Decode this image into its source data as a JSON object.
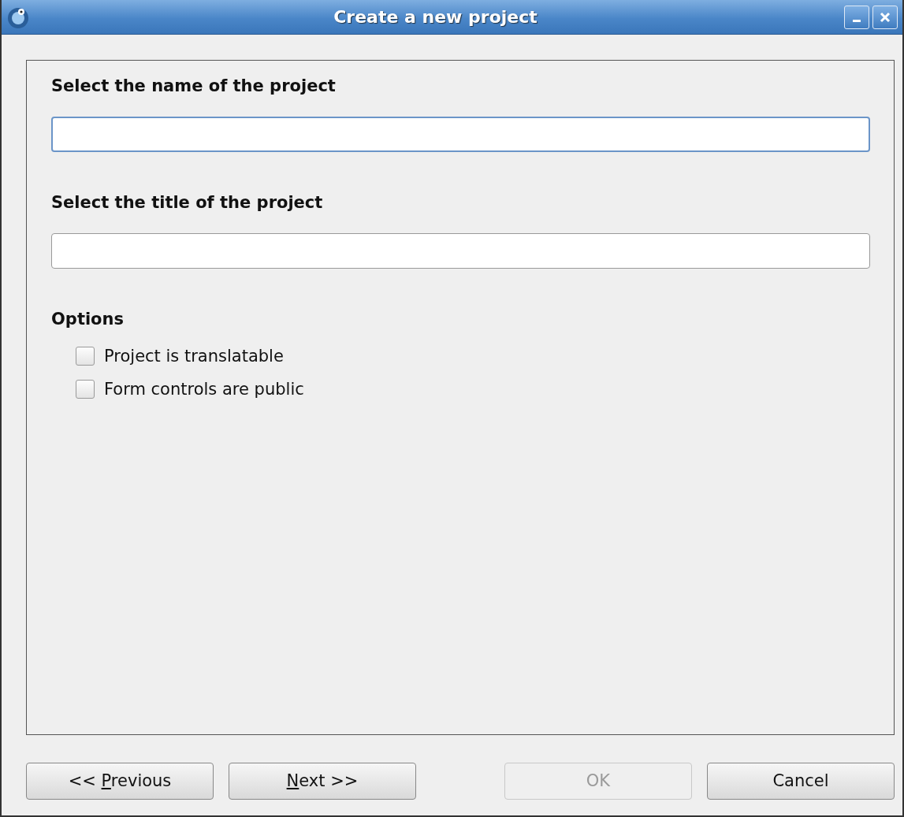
{
  "window": {
    "title": "Create a new project"
  },
  "fields": [
    {
      "label": "Select the name of the project",
      "focused": true
    },
    {
      "label": "Select the title of the project",
      "focused": false
    }
  ],
  "options": {
    "heading": "Options",
    "items": [
      {
        "label": "Project is translatable",
        "checked": false
      },
      {
        "label": "Form controls are public",
        "checked": false
      }
    ]
  },
  "buttons": [
    {
      "prefix": "<< ",
      "mnemonic": "P",
      "rest": "revious",
      "disabled": false
    },
    {
      "mnemonic": "N",
      "rest": "ext >>",
      "disabled": false
    },
    {
      "prefix": "OK",
      "disabled": true
    },
    {
      "prefix": "Cancel",
      "disabled": false
    }
  ]
}
